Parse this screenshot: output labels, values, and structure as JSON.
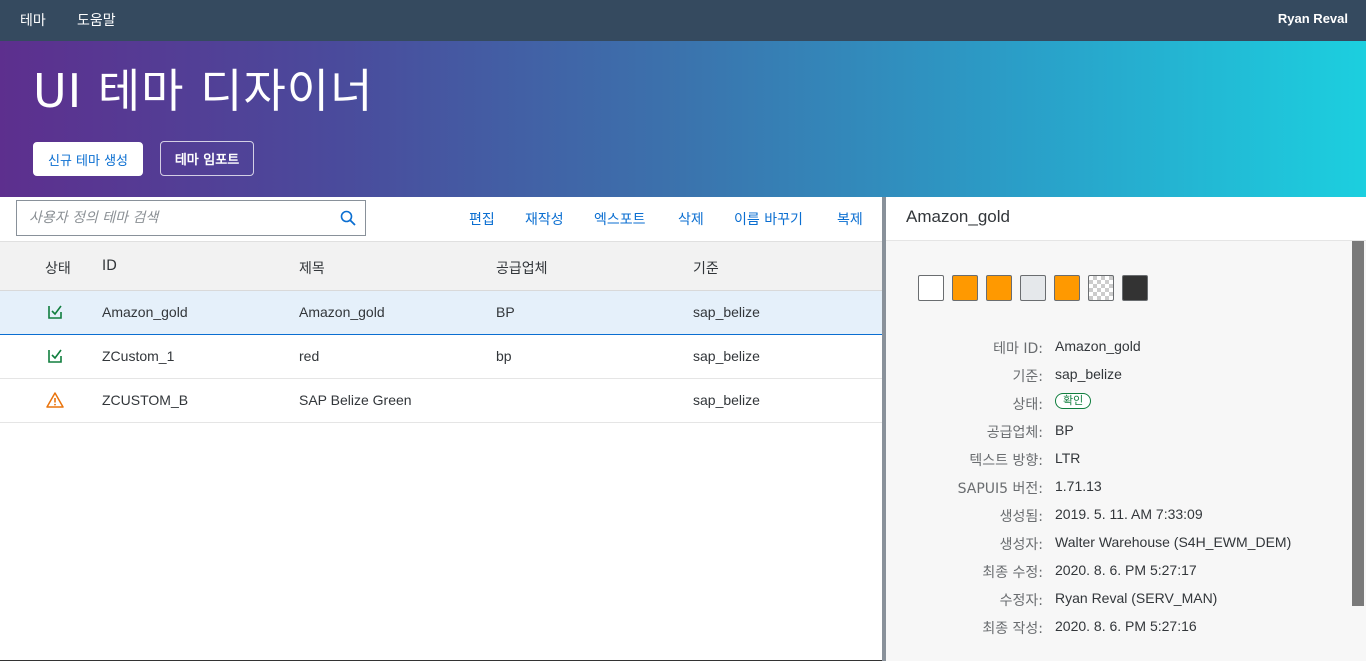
{
  "topbar": {
    "menu_theme": "테마",
    "menu_help": "도움말",
    "user": "Ryan Reval"
  },
  "hero": {
    "title": "UI 테마 디자이너",
    "create_label": "신규 테마 생성",
    "import_label": "테마 임포트"
  },
  "search": {
    "placeholder": "사용자 정의 테마 검색",
    "value": ""
  },
  "actions": {
    "edit": "편집",
    "rebuild": "재작성",
    "export": "엑스포트",
    "delete": "삭제",
    "rename": "이름 바꾸기",
    "copy": "복제"
  },
  "table": {
    "headers": {
      "status": "상태",
      "id": "ID",
      "title": "제목",
      "vendor": "공급업체",
      "base": "기준"
    },
    "rows": [
      {
        "status": "ok",
        "id": "Amazon_gold",
        "title": "Amazon_gold",
        "vendor": "BP",
        "base": "sap_belize"
      },
      {
        "status": "ok",
        "id": "ZCustom_1",
        "title": "red",
        "vendor": "bp",
        "base": "sap_belize"
      },
      {
        "status": "warning",
        "id": "ZCUSTOM_B",
        "title": "SAP Belize Green",
        "vendor": "",
        "base": "sap_belize"
      }
    ]
  },
  "detail": {
    "title": "Amazon_gold",
    "swatches": [
      "#ffffff",
      "#ff9900",
      "#ff9900",
      "#e5e8eb",
      "#ff9900",
      "checker",
      "#333333"
    ],
    "fields": {
      "theme_id_label": "테마 ID:",
      "theme_id": "Amazon_gold",
      "base_label": "기준:",
      "base": "sap_belize",
      "status_label": "상태:",
      "status": "확인",
      "vendor_label": "공급업체:",
      "vendor": "BP",
      "textdir_label": "텍스트 방향:",
      "textdir": "LTR",
      "ui5_label": "SAPUI5 버전:",
      "ui5": "1.71.13",
      "created_label": "생성됨:",
      "created": "2019. 5. 11. AM 7:33:09",
      "creator_label": "생성자:",
      "creator": "Walter Warehouse (S4H_EWM_DEM)",
      "modified_label": "최종 수정:",
      "modified": "2020. 8. 6. PM 5:27:17",
      "modifier_label": "수정자:",
      "modifier": "Ryan Reval (SERV_MAN)",
      "built_label": "최종 작성:",
      "built": "2020. 8. 6. PM 5:27:16"
    }
  },
  "colors": {
    "shell": "#354a5f",
    "accent": "#0a6ed1",
    "success": "#107e3e",
    "warning": "#e9730c"
  }
}
